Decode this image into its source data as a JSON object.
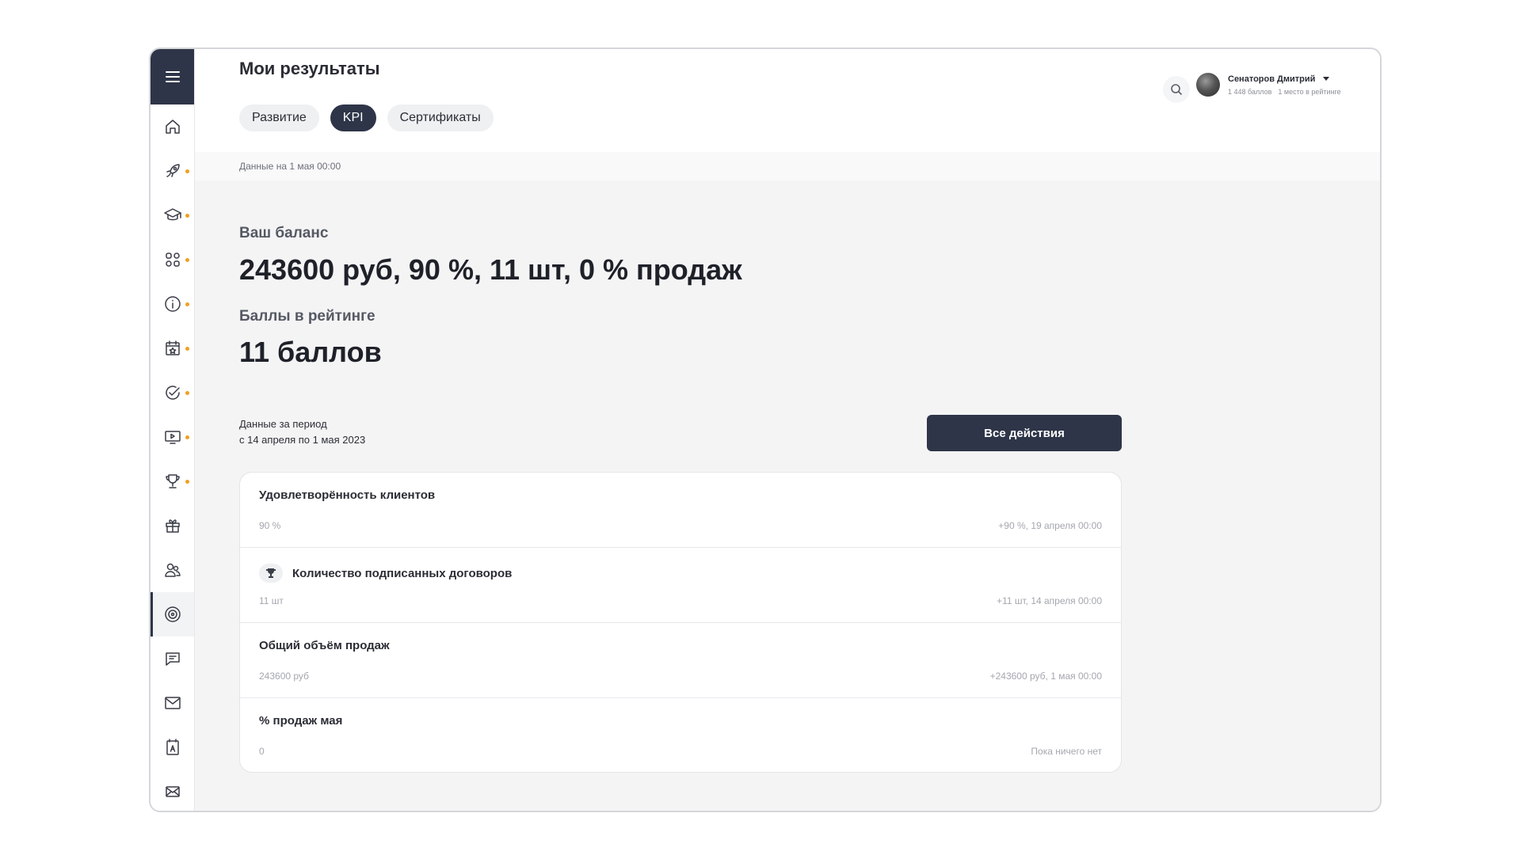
{
  "page": {
    "title": "Мои результаты"
  },
  "tabs": [
    {
      "label": "Развитие",
      "active": false
    },
    {
      "label": "KPI",
      "active": true
    },
    {
      "label": "Сертификаты",
      "active": false
    }
  ],
  "user": {
    "name": "Сенаторов Дмитрий",
    "points": "1 448 баллов",
    "rank": "1 место в рейтинге"
  },
  "sidebar": {
    "items": [
      {
        "icon": "home-icon",
        "dot": false,
        "active": false
      },
      {
        "icon": "rocket-icon",
        "dot": true,
        "active": false
      },
      {
        "icon": "graduation-cap-icon",
        "dot": true,
        "active": false
      },
      {
        "icon": "apps-grid-icon",
        "dot": true,
        "active": false
      },
      {
        "icon": "info-icon",
        "dot": true,
        "active": false
      },
      {
        "icon": "calendar-star-icon",
        "dot": true,
        "active": false
      },
      {
        "icon": "check-circle-icon",
        "dot": true,
        "active": false
      },
      {
        "icon": "video-play-icon",
        "dot": true,
        "active": false
      },
      {
        "icon": "trophy-icon",
        "dot": true,
        "active": false
      },
      {
        "icon": "gift-icon",
        "dot": false,
        "active": false
      },
      {
        "icon": "users-icon",
        "dot": false,
        "active": false
      },
      {
        "icon": "target-icon",
        "dot": false,
        "active": true
      },
      {
        "icon": "chat-icon",
        "dot": false,
        "active": false
      },
      {
        "icon": "mail-icon",
        "dot": false,
        "active": false
      },
      {
        "icon": "translate-icon",
        "dot": false,
        "active": false
      },
      {
        "icon": "envelope-x-icon",
        "dot": false,
        "active": false
      }
    ]
  },
  "data_bar": {
    "text": "Данные на 1 мая 00:00"
  },
  "balance": {
    "label": "Ваш баланс",
    "value": "243600 руб, 90 %, 11 шт, 0 % продаж"
  },
  "rating": {
    "label": "Баллы в рейтинге",
    "value": "11 баллов"
  },
  "period": {
    "label": "Данные за период",
    "range": "с 14 апреля по 1 мая 2023"
  },
  "all_actions_button": "Все действия",
  "kpis": [
    {
      "title": "Удовлетворённость клиентов",
      "value": "90 %",
      "change": "+90 %, 19 апреля 00:00",
      "icon": null
    },
    {
      "title": "Количество подписанных договоров",
      "value": "11 шт",
      "change": "+11 шт, 14 апреля 00:00",
      "icon": "trophy-icon"
    },
    {
      "title": "Общий объём продаж",
      "value": "243600 руб",
      "change": "+243600 руб, 1 мая 00:00",
      "icon": null
    },
    {
      "title": "% продаж мая",
      "value": "0",
      "change": "Пока ничего нет",
      "icon": null
    }
  ],
  "colors": {
    "primary": "#2e3548",
    "accent_dot": "#f0a020",
    "background": "#f4f4f5"
  }
}
